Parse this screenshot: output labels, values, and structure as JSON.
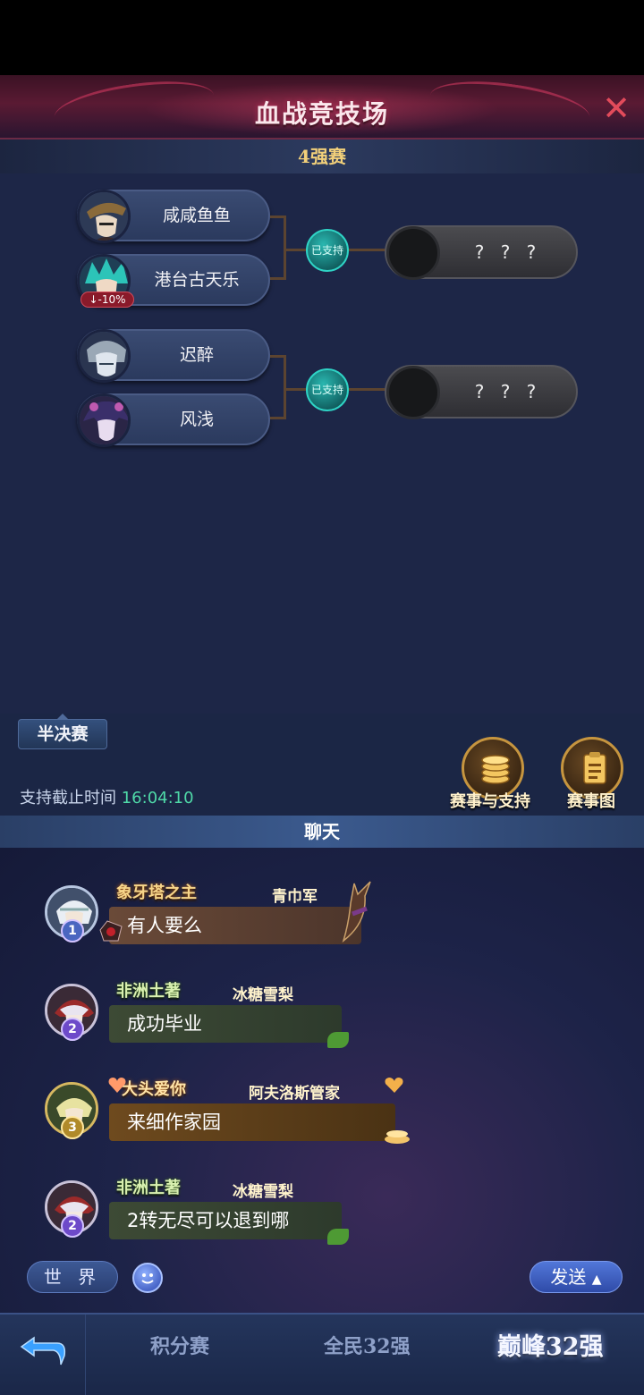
{
  "header": {
    "title": "血战竞技场",
    "close_icon": "close-icon"
  },
  "stage": {
    "title": "4强赛"
  },
  "bracket": {
    "groups": [
      {
        "players": [
          {
            "name": "咸咸鱼鱼",
            "badge": ""
          },
          {
            "name": "港台古天乐",
            "badge": "-10%"
          }
        ],
        "support_label": "已支持",
        "winner_label": "? ? ?"
      },
      {
        "players": [
          {
            "name": "迟醉",
            "badge": ""
          },
          {
            "name": "风浅",
            "badge": ""
          }
        ],
        "support_label": "已支持",
        "winner_label": "? ? ?"
      }
    ]
  },
  "info": {
    "round_tag": "半决赛",
    "deadline_label": "支持截止时间",
    "deadline_time": "16:04:10",
    "events_support_label": "赛事与支持",
    "bracket_label": "赛事图"
  },
  "chat": {
    "header": "聊天",
    "messages": [
      {
        "title": "象牙塔之主",
        "user": "青巾军",
        "text": "有人要么",
        "rank": "1"
      },
      {
        "title": "非洲土著",
        "user": "冰糖雪梨",
        "text": "成功毕业",
        "rank": "2"
      },
      {
        "title": "大头爱你",
        "user": "阿夫洛斯管家",
        "text": "来细作家园",
        "rank": "3"
      },
      {
        "title": "非洲土著",
        "user": "冰糖雪梨",
        "text": "2转无尽可以退到哪",
        "rank": "2"
      }
    ],
    "channel": "世 界",
    "send": "发送"
  },
  "nav": {
    "tabs": [
      "积分赛",
      "全民32强",
      "巅峰32强"
    ],
    "active": "巅峰32强"
  },
  "colors": {
    "accent_gold": "#f2d07a",
    "time_green": "#4fd9a8",
    "support_teal": "#2ab7b0"
  }
}
